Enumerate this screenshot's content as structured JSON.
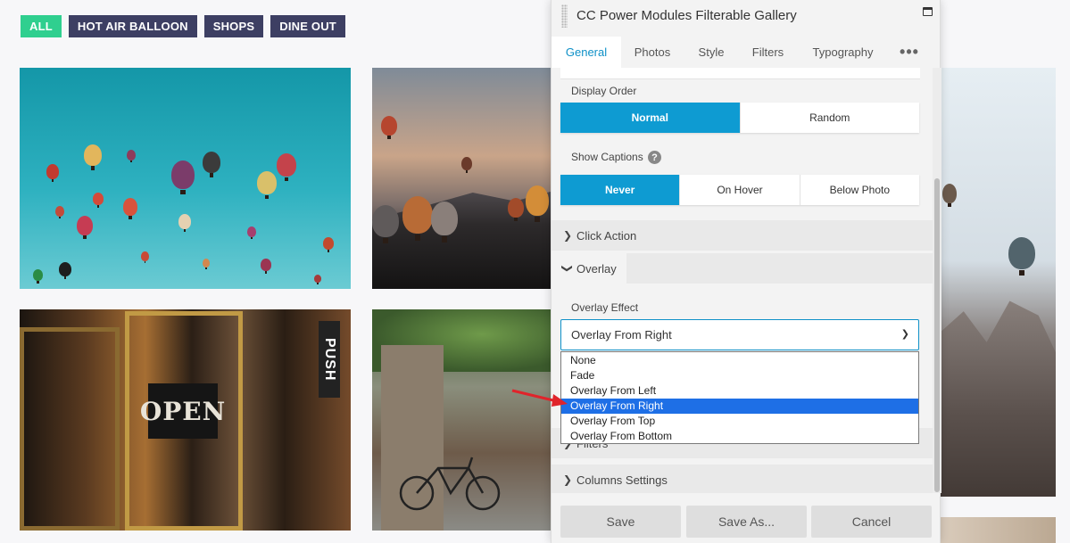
{
  "gallery": {
    "filters": [
      {
        "label": "ALL",
        "active": true
      },
      {
        "label": "HOT AIR BALLOON",
        "active": false
      },
      {
        "label": "SHOPS",
        "active": false
      },
      {
        "label": "DINE OUT",
        "active": false
      }
    ],
    "signs": {
      "push": "PUSH",
      "open": "OPEN"
    }
  },
  "panel": {
    "title": "CC Power Modules Filterable Gallery",
    "tabs": [
      "General",
      "Photos",
      "Style",
      "Filters",
      "Typography"
    ],
    "more_label": "•••",
    "display_order": {
      "label": "Display Order",
      "options": [
        "Normal",
        "Random"
      ],
      "selected": "Normal"
    },
    "show_captions": {
      "label": "Show Captions",
      "help": "?",
      "options": [
        "Never",
        "On Hover",
        "Below Photo"
      ],
      "selected": "Never"
    },
    "sections": {
      "click_action": "Click Action",
      "overlay": "Overlay",
      "filters": "Filters",
      "columns": "Columns Settings"
    },
    "overlay_effect": {
      "label": "Overlay Effect",
      "value": "Overlay From Right",
      "options": [
        "None",
        "Fade",
        "Overlay From Left",
        "Overlay From Right",
        "Overlay From Top",
        "Overlay From Bottom"
      ]
    },
    "footer": {
      "save": "Save",
      "save_as": "Save As...",
      "cancel": "Cancel"
    }
  },
  "colors": {
    "accent": "#0e9bd2",
    "filter_active": "#2fcf8f",
    "filter": "#3d3f63",
    "selected_option": "#1e6fe6",
    "annotation_arrow": "#e0242b"
  }
}
